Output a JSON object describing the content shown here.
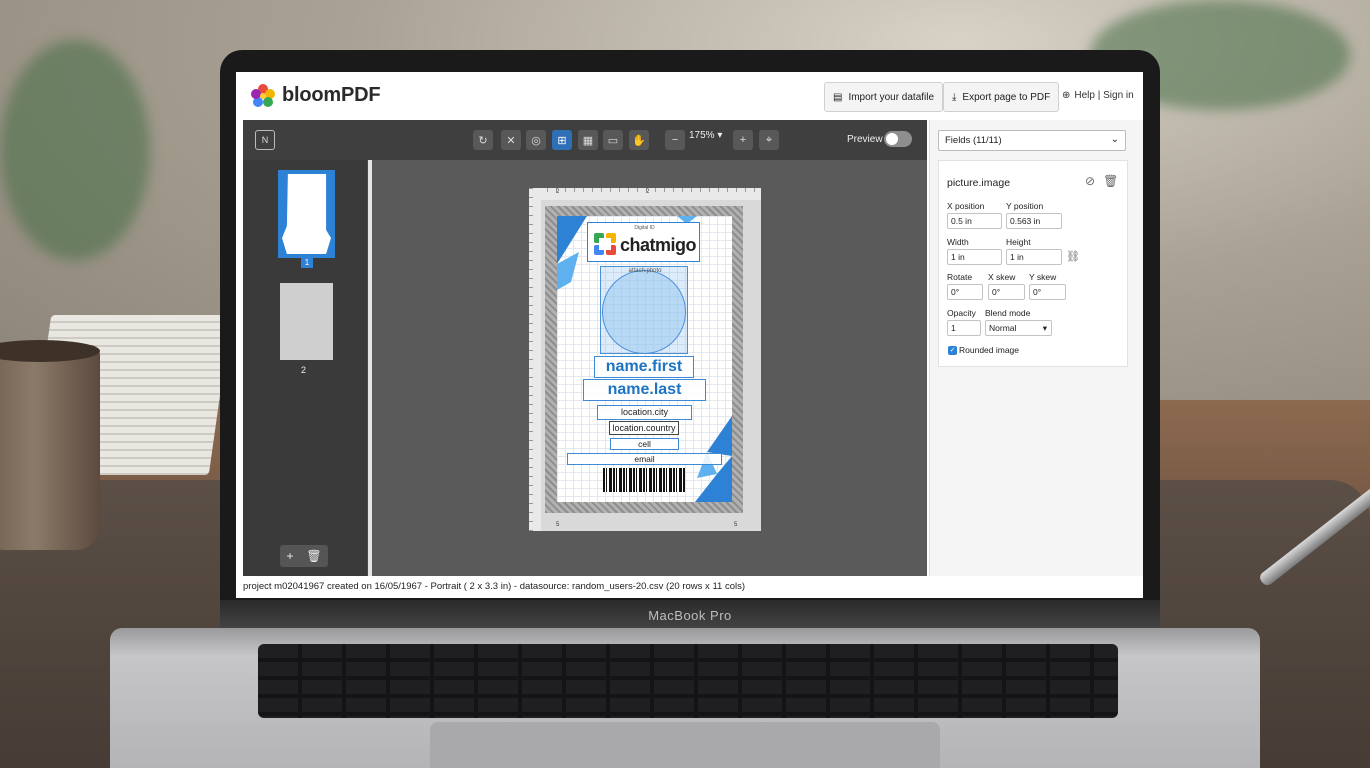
{
  "hardware": {
    "brand_label": "MacBook Pro"
  },
  "app": {
    "name": "bloomPDF",
    "header": {
      "import_label": "Import your datafile",
      "export_label": "Export page to PDF",
      "help_label": "Help | Sign in"
    },
    "toolbar": {
      "zoom_value": "175%",
      "preview_label": "Preview",
      "preview_enabled": false
    },
    "pages": [
      {
        "number": "1",
        "selected": true
      },
      {
        "number": "2",
        "selected": false
      }
    ],
    "card": {
      "small_caption": "Digital ID",
      "brand": "chatmigo",
      "photo_label": "attach.photo",
      "fields": {
        "first": "name.first",
        "last": "name.last",
        "city": "location.city",
        "country": "location.country",
        "cell": "cell",
        "email": "email"
      },
      "ruler_h_marks": [
        "2",
        "2",
        "5",
        "5"
      ],
      "accent_color": "#2d82d6"
    },
    "sidebar": {
      "fields_select": "Fields (11/11)",
      "element_name": "picture.image",
      "labels": {
        "x_position": "X position",
        "y_position": "Y position",
        "width": "Width",
        "height": "Height",
        "rotate": "Rotate",
        "x_skew": "X skew",
        "y_skew": "Y skew",
        "opacity": "Opacity",
        "blend_mode": "Blend mode",
        "rounded_image": "Rounded image"
      },
      "values": {
        "x_position": "0.5 in",
        "y_position": "0.563 in",
        "width": "1 in",
        "height": "1 in",
        "rotate": "0°",
        "x_skew": "0°",
        "y_skew": "0°",
        "opacity": "1",
        "blend_mode": "Normal",
        "rounded_image": true
      }
    },
    "status": "project m02041967 created on 16/05/1967 - Portrait ( 2 x 3.3 in) - datasource: random_users-20.csv (20 rows x 11 cols)"
  }
}
